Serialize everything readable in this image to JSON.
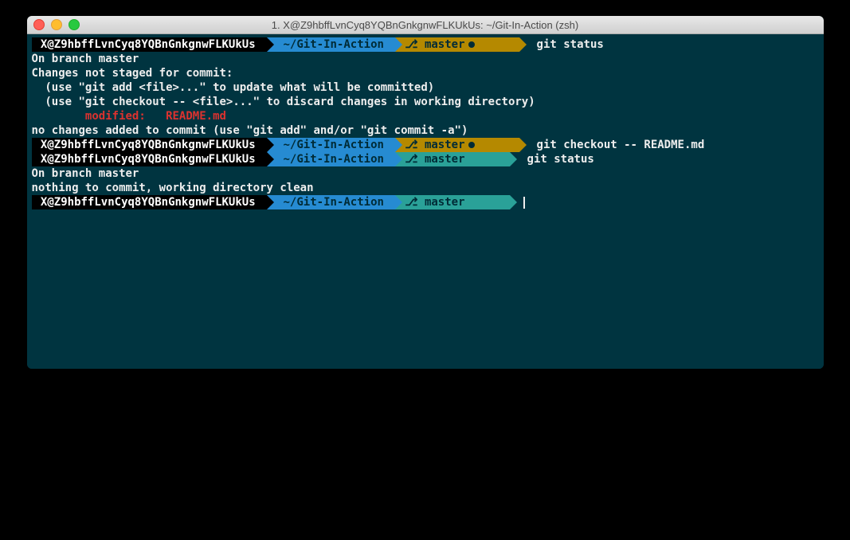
{
  "window": {
    "title": "1. X@Z9hbffLvnCyq8YQBnGnkgnwFLKUkUs: ~/Git-In-Action (zsh)"
  },
  "prompt": {
    "user_host": " X@Z9hbffLvnCyq8YQBnGnkgnwFLKUkUs ",
    "path": " ~/Git-In-Action ",
    "branch_label": " master",
    "branch_glyph": "⎇"
  },
  "commands": {
    "c1": " git status",
    "c2": " git checkout -- README.md",
    "c3": " git status",
    "c4": ""
  },
  "output": {
    "l1": "On branch master",
    "l2": "Changes not staged for commit:",
    "l3": "  (use \"git add <file>...\" to update what will be committed)",
    "l4": "  (use \"git checkout -- <file>...\" to discard changes in working directory)",
    "l5": "",
    "l6": "        modified:   README.md",
    "l7": "",
    "l8": "no changes added to commit (use \"git add\" and/or \"git commit -a\")",
    "l9": "On branch master",
    "l10": "nothing to commit, working directory clean"
  }
}
